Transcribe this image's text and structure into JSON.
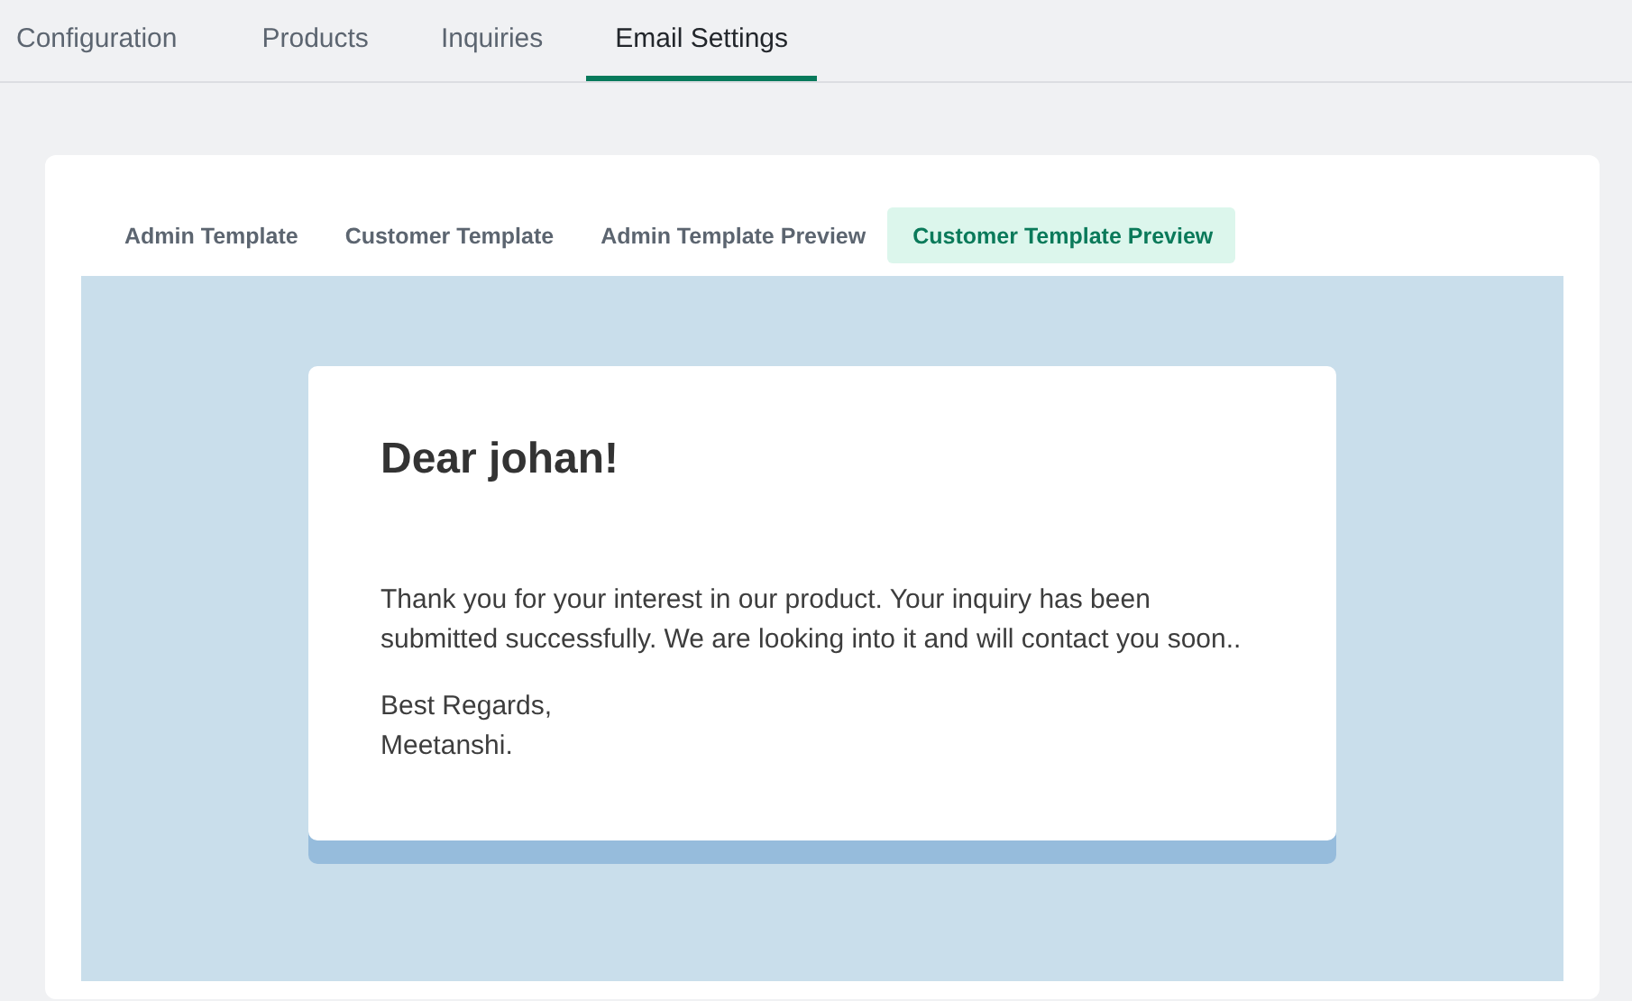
{
  "tabs": [
    {
      "label": "Configuration",
      "selected": false
    },
    {
      "label": "Products",
      "selected": false
    },
    {
      "label": "Inquiries",
      "selected": false
    },
    {
      "label": "Email Settings",
      "selected": true
    }
  ],
  "subtabs": [
    {
      "label": "Admin Template",
      "selected": false
    },
    {
      "label": "Customer Template",
      "selected": false
    },
    {
      "label": "Admin Template Preview",
      "selected": false
    },
    {
      "label": "Customer Template Preview",
      "selected": true
    }
  ],
  "email": {
    "greeting": "Dear johan!",
    "body": "Thank you for your interest in our product. Your inquiry has been submitted successfully. We are looking into it and will contact you soon..",
    "signoff": [
      "Best Regards,",
      "Meetanshi."
    ]
  }
}
